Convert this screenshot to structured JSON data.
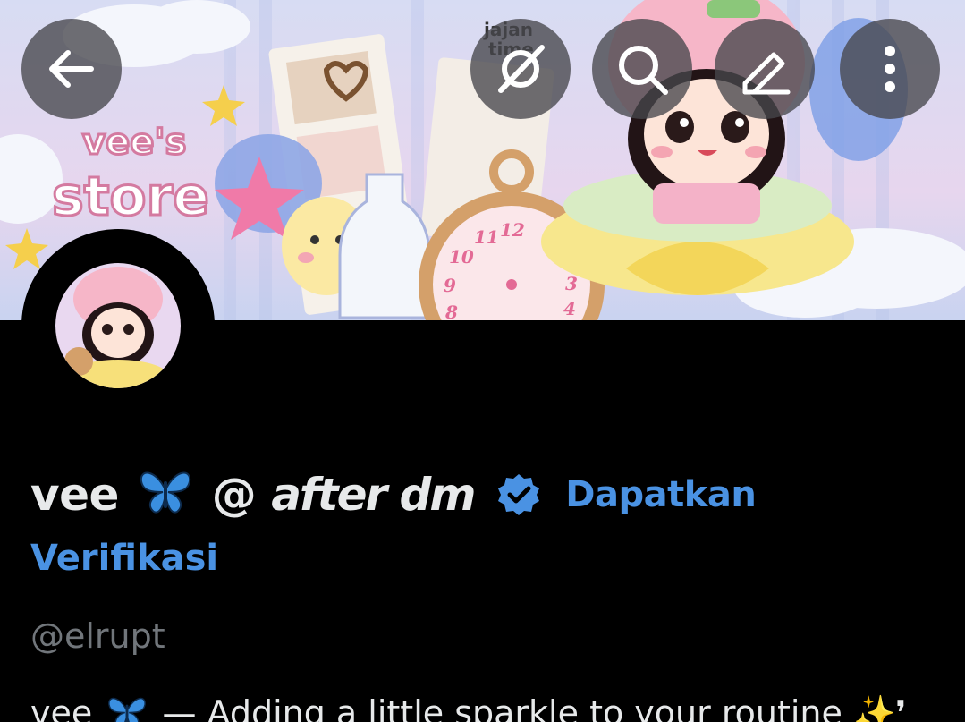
{
  "header": {
    "back_icon": "arrow-left-icon",
    "grok_icon": "grok-icon",
    "search_icon": "search-icon",
    "edit_icon": "edit-icon",
    "more_icon": "more-vertical-icon",
    "button_background": "#46464b"
  },
  "banner": {
    "store_line1": "vee's",
    "store_line2": "store",
    "corner_text_line1": "jajan",
    "corner_text_line2": "time"
  },
  "profile": {
    "display_name_prefix": "vee",
    "name_emoji": "butterfly-icon",
    "display_name_at": "@",
    "display_name_italic": "after dm",
    "get_verified_part1": "Dapatkan",
    "get_verified_part2": "Verifikasi",
    "handle": "@elrupt",
    "bio_prefix": "vee",
    "bio_text": "— Adding a little sparkle to your routine ✨❜",
    "accent_color": "#4a92e3",
    "handle_color": "#71767b"
  }
}
